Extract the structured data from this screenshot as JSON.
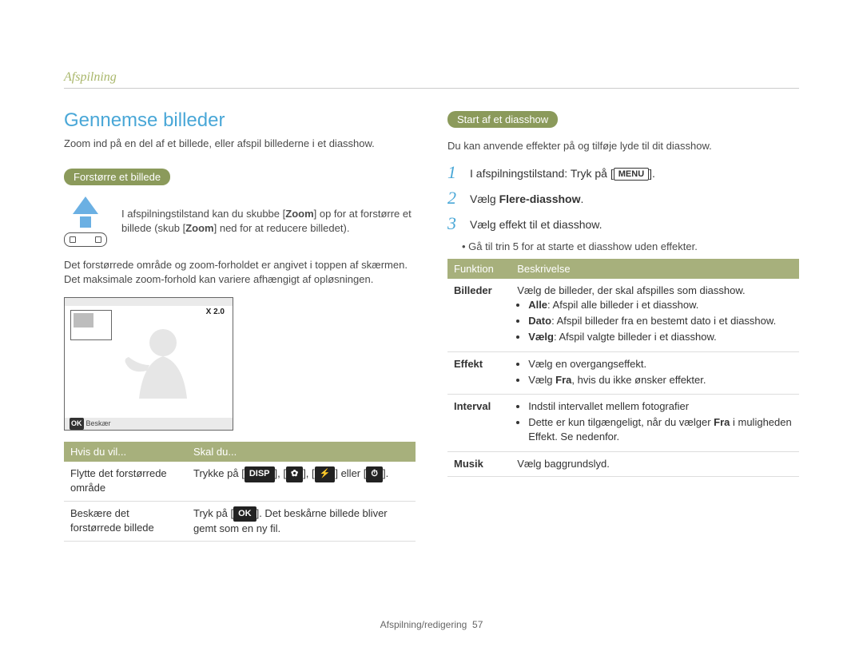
{
  "section_top": "Afspilning",
  "h1": "Gennemse billeder",
  "intro": "Zoom ind på en del af et billede, eller afspil billederne i et diasshow.",
  "left_pill": "Forstørre et billede",
  "zoom_text": {
    "pre": "I afspilningstilstand kan du skubbe [",
    "zoom1": "Zoom",
    "mid": "] op for at forstørre et billede (skub [",
    "zoom2": "Zoom",
    "post": "] ned for at reducere billedet)."
  },
  "para_zoom": "Det forstørrede område og zoom-forholdet er angivet i toppen af skærmen. Det maksimale zoom-forhold kan variere afhængigt af opløsningen.",
  "illu_zoom_label": "X 2.0",
  "illu_bottom": "Beskær",
  "left_table_head": {
    "c1": "Hvis du vil...",
    "c2": "Skal du..."
  },
  "left_table_rows": [
    {
      "c1": "Flytte det forstørrede område",
      "c2_pre": "Trykke på [",
      "c2_key1": "DISP",
      "c2_mid1": "], [",
      "c2_key2": "✿",
      "c2_mid2": "], [",
      "c2_key3": "⚡",
      "c2_mid3": "] eller [",
      "c2_key4": "⏱",
      "c2_post": "]."
    },
    {
      "c1": "Beskære det forstørrede billede",
      "c2_pre": "Tryk på [",
      "c2_key1": "OK",
      "c2_post": "]. Det beskårne billede bliver gemt som en ny fil."
    }
  ],
  "right_pill": "Start af et diasshow",
  "right_intro": "Du kan anvende effekter på og tilføje lyde til dit diasshow.",
  "steps": [
    {
      "num": "1",
      "text_pre": "I afspilningstilstand: Tryk på [",
      "key": "MENU",
      "text_post": "]."
    },
    {
      "num": "2",
      "text_pre": "Vælg ",
      "bold": "Flere-diasshow",
      "text_post": "."
    },
    {
      "num": "3",
      "text_pre": "Vælg effekt til et diasshow.",
      "bold": "",
      "text_post": ""
    }
  ],
  "sub_bullet": "Gå til trin 5 for at starte et diasshow uden effekter.",
  "right_table_head": {
    "c1": "Funktion",
    "c2": "Beskrivelse"
  },
  "right_table": {
    "billeder": {
      "label": "Billeder",
      "lead": "Vælg de billeder, der skal afspilles som diasshow.",
      "b1_bold": "Alle",
      "b1_rest": ": Afspil alle billeder i et diasshow.",
      "b2_bold": "Dato",
      "b2_rest": ": Afspil billeder fra en bestemt dato i et diasshow.",
      "b3_bold": "Vælg",
      "b3_rest": ": Afspil valgte billeder i et diasshow."
    },
    "effekt": {
      "label": "Effekt",
      "b1": "Vælg en overgangseffekt.",
      "b2_pre": "Vælg ",
      "b2_bold": "Fra",
      "b2_rest": ", hvis du ikke ønsker effekter."
    },
    "interval": {
      "label": "Interval",
      "b1": "Indstil intervallet mellem fotografier",
      "b2_pre": "Dette er kun tilgængeligt, når du vælger ",
      "b2_bold": "Fra",
      "b2_rest": " i muligheden Effekt. Se nedenfor."
    },
    "musik": {
      "label": "Musik",
      "text": "Vælg baggrundslyd."
    }
  },
  "footer_text": "Afspilning/redigering",
  "footer_page": "57"
}
